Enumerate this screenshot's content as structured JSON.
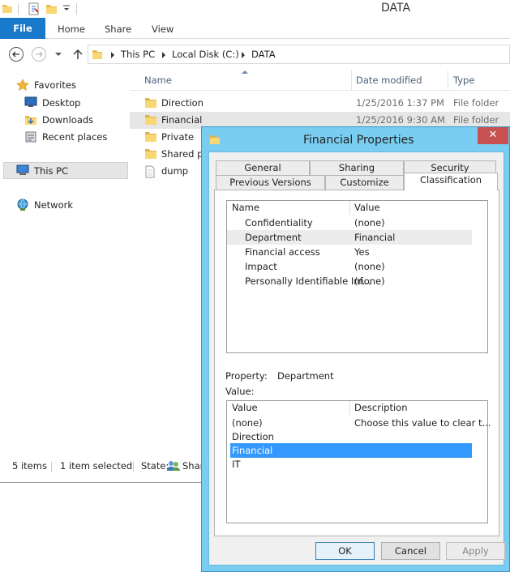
{
  "window": {
    "title": "DATA"
  },
  "ribbon": {
    "file": "File",
    "tabs": [
      "Home",
      "Share",
      "View"
    ]
  },
  "address": {
    "segments": [
      "This PC",
      "Local Disk (C:)",
      "DATA"
    ]
  },
  "nav": {
    "favorites": "Favorites",
    "desktop": "Desktop",
    "downloads": "Downloads",
    "recent": "Recent places",
    "thispc": "This PC",
    "network": "Network"
  },
  "columns": {
    "name": "Name",
    "date": "Date modified",
    "type": "Type"
  },
  "files": [
    {
      "name": "Direction",
      "date": "1/25/2016 1:37 PM",
      "type": "File folder"
    },
    {
      "name": "Financial",
      "date": "1/25/2016 9:30 AM",
      "type": "File folder"
    },
    {
      "name": "Private",
      "date": "",
      "type": ""
    },
    {
      "name": "Shared pu",
      "date": "",
      "type": ""
    },
    {
      "name": "dump",
      "date": "",
      "type": ""
    }
  ],
  "status": {
    "items": "5 items",
    "selected": "1 item selected",
    "state_label": "State:",
    "state_value": "Shar"
  },
  "dialog": {
    "title": "Financial Properties",
    "close": "✕",
    "tabs_top": [
      "General",
      "Sharing",
      "Security"
    ],
    "tabs_bottom": [
      "Previous Versions",
      "Customize",
      "Classification"
    ],
    "props_headers": {
      "name": "Name",
      "value": "Value"
    },
    "props": [
      {
        "name": "Confidentiality",
        "value": "(none)"
      },
      {
        "name": "Department",
        "value": "Financial"
      },
      {
        "name": "Financial access",
        "value": "Yes"
      },
      {
        "name": "Impact",
        "value": "(none)"
      },
      {
        "name": "Personally Identifiable Inf...",
        "value": "(none)"
      }
    ],
    "property_label": "Property:",
    "property_value": "Department",
    "value_label": "Value:",
    "values_headers": {
      "value": "Value",
      "description": "Description"
    },
    "values": [
      {
        "value": "(none)",
        "description": "Choose this value to clear t..."
      },
      {
        "value": "Direction",
        "description": ""
      },
      {
        "value": "Financial",
        "description": ""
      },
      {
        "value": "IT",
        "description": ""
      }
    ],
    "buttons": {
      "ok": "OK",
      "cancel": "Cancel",
      "apply": "Apply"
    }
  },
  "colors": {
    "accent": "#1979ca",
    "selection": "#3399ff",
    "dialog_frame": "#79cdf0",
    "close": "#c75050"
  }
}
